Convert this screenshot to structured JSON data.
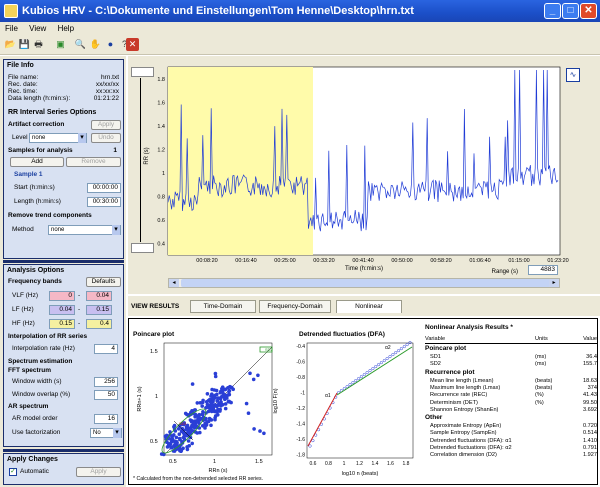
{
  "window": {
    "title": "Kubios HRV - C:\\Dokumente und Einstellungen\\Tom Henne\\Desktop\\hrn.txt"
  },
  "menu": {
    "items": [
      "File",
      "View",
      "Help"
    ]
  },
  "file_info": {
    "heading": "File Info",
    "rows": [
      {
        "label": "File name:",
        "value": "hrn.txt"
      },
      {
        "label": "Rec. date:",
        "value": "xx/xx/xx"
      },
      {
        "label": "Rec. time:",
        "value": "xx:xx:xx"
      },
      {
        "label": "Data length (h:min:s):",
        "value": "01:21:22"
      }
    ]
  },
  "rr_options": {
    "heading": "RR Interval Series Options",
    "artifact_label": "Artifact correction",
    "apply": "Apply",
    "level_label": "Level",
    "level_value": "none",
    "undo": "Undo",
    "samples_label": "Samples for analysis",
    "samples_count": "1",
    "add": "Add",
    "remove": "Remove",
    "sample_name": "Sample 1",
    "start_label": "Start (h:min:s)",
    "start_value": "00:00:00",
    "length_label": "Length (h:min:s)",
    "length_value": "00:30:00",
    "trend_label": "Remove trend components",
    "method_label": "Method",
    "method_value": "none"
  },
  "analysis_options": {
    "heading": "Analysis Options",
    "freq_label": "Frequency bands",
    "defaults": "Defaults",
    "bands": [
      {
        "label": "VLF (Hz)",
        "lo": "0",
        "hi": "0.04",
        "color": "#f5b8c6"
      },
      {
        "label": "LF (Hz)",
        "lo": "0.04",
        "hi": "0.15",
        "color": "#c8bff0"
      },
      {
        "label": "HF (Hz)",
        "lo": "0.15",
        "hi": "0.4",
        "color": "#f5f0a0"
      }
    ],
    "interp_heading": "Interpolation of RR series",
    "interp_label": "Interpolation rate (Hz)",
    "interp_value": "4",
    "spec_heading": "Spectrum estimation",
    "fft_heading": "FFT spectrum",
    "win_width_label": "Window width (s)",
    "win_width_value": "256",
    "win_overlap_label": "Window overlap (%)",
    "win_overlap_value": "50",
    "ar_heading": "AR spectrum",
    "ar_order_label": "AR model order",
    "ar_order_value": "16",
    "factor_label": "Use factorization",
    "factor_value": "No"
  },
  "apply_changes": {
    "heading": "Apply Changes",
    "automatic": "Automatic",
    "apply": "Apply"
  },
  "rr_chart": {
    "ylabel": "RR (s)",
    "yticks": [
      "0.4",
      "0.6",
      "0.8",
      "1",
      "1.2",
      "1.4",
      "1.6",
      "1.8"
    ],
    "xticks": [
      "00:08:20",
      "00:16:40",
      "00:25:00",
      "00:33:20",
      "00:41:40",
      "00:50:00",
      "00:58:20",
      "01:06:40",
      "01:15:00",
      "01:23:20"
    ],
    "xlabel": "Time (h:min:s)",
    "range_label": "Range (s)",
    "range_value": "4883"
  },
  "tabs": {
    "view_results": "VIEW RESULTS",
    "items": [
      "Time-Domain",
      "Frequency-Domain",
      "Nonlinear"
    ],
    "active": 2
  },
  "poincare": {
    "title": "Poincare plot",
    "xlabel": "RRn (s)",
    "ylabel": "RRn+1 (s)",
    "ticks": [
      "0.5",
      "1",
      "1.5"
    ],
    "sd1": "SD1",
    "sd2": "SD2"
  },
  "dfa": {
    "title": "Detrended fluctuatios (DFA)",
    "xlabel": "log10 n (beats)",
    "ylabel": "log10 F(n)",
    "xticks": [
      "0.6",
      "0.8",
      "1",
      "1.2",
      "1.4",
      "1.6",
      "1.8"
    ],
    "yticks": [
      "-0.4",
      "-0.6",
      "-0.8",
      "-1",
      "-1.2",
      "-1.4",
      "-1.6",
      "-1.8"
    ],
    "alpha1": "α1",
    "alpha2": "α2"
  },
  "footnote": "* Calculated from the non-detrended selected RR series.",
  "results": {
    "title": "Nonlinear Analysis Results *",
    "headers": [
      "Variable",
      "Units",
      "Value"
    ],
    "sections": [
      {
        "name": "Poincare plot",
        "rows": [
          [
            "SD1",
            "(ms)",
            "36.4"
          ],
          [
            "SD2",
            "(ms)",
            "155.7"
          ]
        ]
      },
      {
        "name": "Recurrence plot",
        "rows": [
          [
            "Mean line length (Lmean)",
            "(beats)",
            "18.63"
          ],
          [
            "Maximum line length (Lmax)",
            "(beats)",
            "374"
          ],
          [
            "Recurrence rate (REC)",
            "(%)",
            "41.43"
          ],
          [
            "Determinism (DET)",
            "(%)",
            "99.50"
          ],
          [
            "Shannon Entropy (ShanEn)",
            "",
            "3.692"
          ]
        ]
      },
      {
        "name": "Other",
        "rows": [
          [
            "Approximate Entropy (ApEn)",
            "",
            "0.720"
          ],
          [
            "Sample Entropy (SampEn)",
            "",
            "0.514"
          ],
          [
            "Detrended fluctuations (DFA): α1",
            "",
            "1.410"
          ],
          [
            "Detrended fluctuations (DFA): α2",
            "",
            "0.791"
          ],
          [
            "Correlation dimension (D2)",
            "",
            "1.927"
          ]
        ]
      }
    ]
  }
}
